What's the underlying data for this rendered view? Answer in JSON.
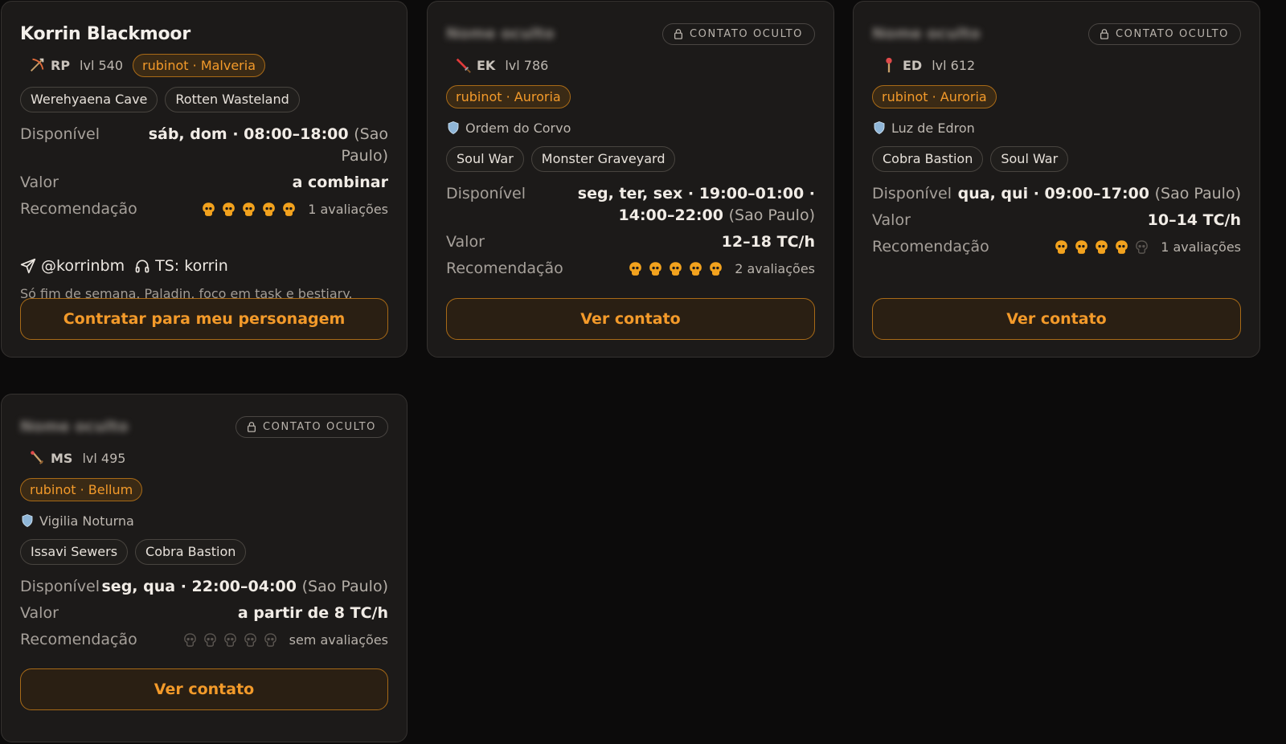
{
  "cards": [
    {
      "name": "Korrin Blackmoor",
      "name_hidden": false,
      "vocation": "RP",
      "vocation_icon": "bow-icon",
      "level": "lvl 540",
      "server": "rubinot · Malveria",
      "tags": [
        "Werehyaena Cave",
        "Rotten Wasteland"
      ],
      "available_label": "Disponível",
      "available_days": "sáb, dom · 08:00–18:00",
      "available_tz": "(Sao Paulo)",
      "price_label": "Valor",
      "price": "a combinar",
      "rating_label": "Recomendação",
      "rating": 5,
      "rating_count": "1 avaliações",
      "telegram": "@korrinbm",
      "teamspeak": "TS: korrin",
      "note": "Só fim de semana. Paladin, foco em task e bestiary.",
      "button": "Contratar para meu personagem"
    },
    {
      "name": "Nome oculto",
      "name_hidden": true,
      "hidden_label": "CONTATO OCULTO",
      "vocation": "EK",
      "vocation_icon": "sword-icon",
      "level": "lvl 786",
      "server": "rubinot · Auroria",
      "guild": "Ordem do Corvo",
      "tags": [
        "Soul War",
        "Monster Graveyard"
      ],
      "available_label": "Disponível",
      "available_days": "seg, ter, sex · 19:00–01:00 · 14:00–22:00",
      "available_tz": "(Sao Paulo)",
      "price_label": "Valor",
      "price": "12–18 TC/h",
      "rating_label": "Recomendação",
      "rating": 5,
      "rating_count": "2 avaliações",
      "button": "Ver contato"
    },
    {
      "name": "Nome oculto",
      "name_hidden": true,
      "hidden_label": "CONTATO OCULTO",
      "vocation": "ED",
      "vocation_icon": "rod-icon",
      "level": "lvl 612",
      "server": "rubinot · Auroria",
      "guild": "Luz de Edron",
      "tags": [
        "Cobra Bastion",
        "Soul War"
      ],
      "available_label": "Disponível",
      "available_days": "qua, qui · 09:00–17:00",
      "available_tz": "(Sao Paulo)",
      "price_label": "Valor",
      "price": "10–14 TC/h",
      "rating_label": "Recomendação",
      "rating": 4,
      "rating_count": "1 avaliações",
      "button": "Ver contato"
    },
    {
      "name": "Nome oculto",
      "name_hidden": true,
      "hidden_label": "CONTATO OCULTO",
      "vocation": "MS",
      "vocation_icon": "wand-icon",
      "level": "lvl 495",
      "server": "rubinot · Bellum",
      "guild": "Vigilia Noturna",
      "tags": [
        "Issavi Sewers",
        "Cobra Bastion"
      ],
      "available_label": "Disponível",
      "available_days": "seg, qua · 22:00–04:00",
      "available_tz": "(Sao Paulo)",
      "price_label": "Valor",
      "price": "a partir de 8 TC/h",
      "rating_label": "Recomendação",
      "rating": 0,
      "rating_count": "sem avaliações",
      "button": "Ver contato"
    }
  ],
  "colors": {
    "accent": "#f39a2a",
    "skull_on": "#f2a21e",
    "skull_off": "#5a5550"
  }
}
